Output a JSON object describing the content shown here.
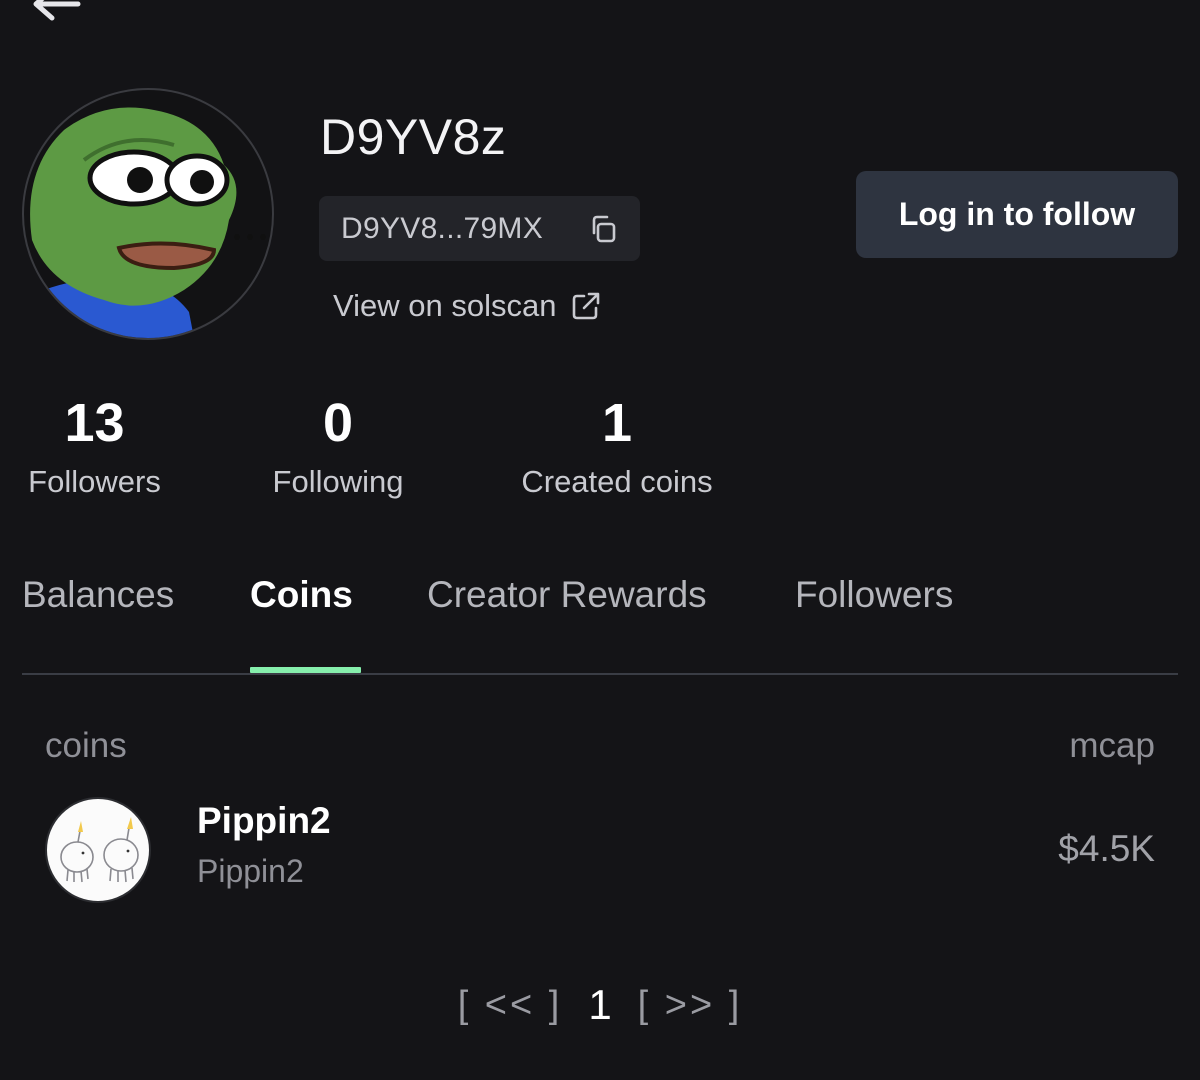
{
  "profile": {
    "username": "D9YV8z",
    "address_short": "D9YV8...79MX",
    "solscan_label": "View on solscan",
    "avatar_icon": "pepe-frog-avatar",
    "copy_icon": "copy-icon",
    "external_icon": "external-link-icon"
  },
  "actions": {
    "follow_label": "Log in to follow"
  },
  "stats": {
    "followers": {
      "value": "13",
      "label": "Followers"
    },
    "following": {
      "value": "0",
      "label": "Following"
    },
    "created": {
      "value": "1",
      "label": "Created coins"
    }
  },
  "tabs": [
    {
      "label": "Balances",
      "active": false
    },
    {
      "label": "Coins",
      "active": true
    },
    {
      "label": "Creator Rewards",
      "active": false
    },
    {
      "label": "Followers",
      "active": false
    }
  ],
  "coins_table": {
    "headers": {
      "coins": "coins",
      "mcap": "mcap"
    },
    "rows": [
      {
        "name": "Pippin2",
        "ticker": "Pippin2",
        "mcap": "$4.5K",
        "icon": "pippin-unicorn-image"
      }
    ]
  },
  "pagination": {
    "prev": "[ << ]",
    "current": "1",
    "next": "[ >> ]"
  },
  "colors": {
    "background": "#141417",
    "accent": "#86efac",
    "button": "#2e3440"
  }
}
